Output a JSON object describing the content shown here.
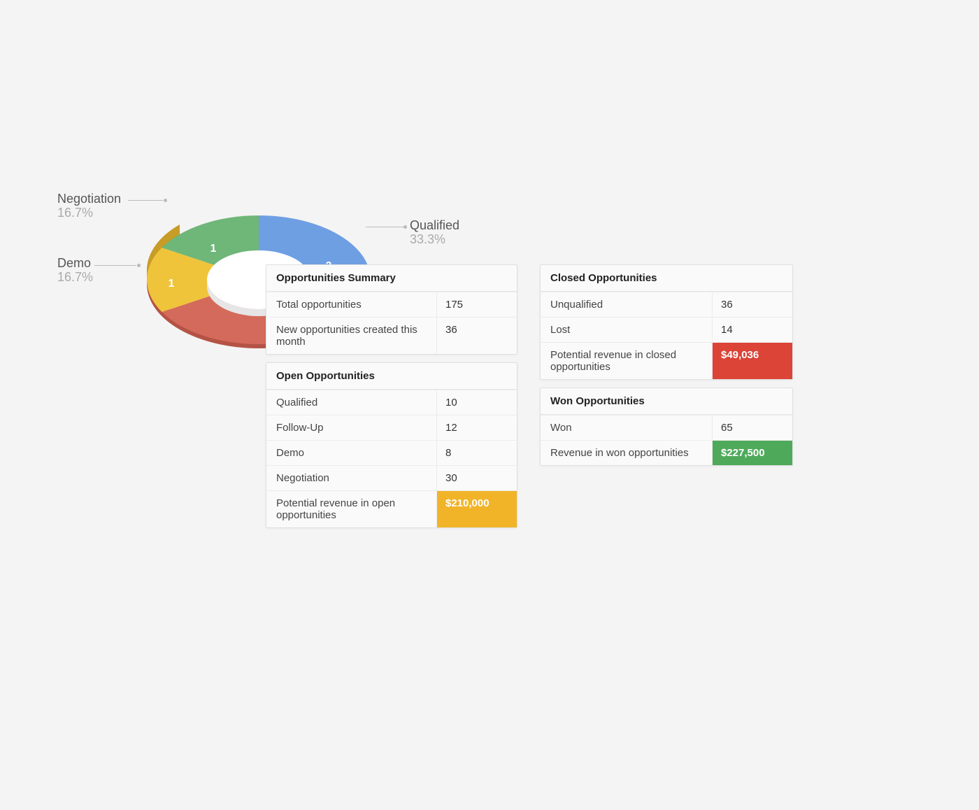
{
  "chart_data": {
    "type": "pie",
    "style": "3d-donut",
    "series": [
      {
        "name": "Qualified",
        "value": 2,
        "percent": "33.3%",
        "color": "#6f9fe3"
      },
      {
        "name": "Follow-Up",
        "value": 2,
        "percent": "33.3%",
        "color": "#d46a5b"
      },
      {
        "name": "Demo",
        "value": 1,
        "percent": "16.7%",
        "color": "#efc43b"
      },
      {
        "name": "Negotiation",
        "value": 1,
        "percent": "16.7%",
        "color": "#6fb679"
      }
    ],
    "inner_radius_ratio": 0.45,
    "visible_labels": [
      "Qualified",
      "Demo",
      "Negotiation"
    ]
  },
  "labels": {
    "qualified": {
      "name": "Qualified",
      "pct": "33.3%"
    },
    "demo": {
      "name": "Demo",
      "pct": "16.7%"
    },
    "negotiation": {
      "name": "Negotiation",
      "pct": "16.7%"
    }
  },
  "slice_counts": {
    "qualified": "2",
    "demo": "1",
    "negotiation": "1"
  },
  "panels": {
    "summary": {
      "title": "Opportunities Summary",
      "rows": [
        {
          "label": "Total opportunities",
          "value": "175"
        },
        {
          "label": "New opportunities created this month",
          "value": "36"
        }
      ]
    },
    "open": {
      "title": "Open Opportunities",
      "rows": [
        {
          "label": "Qualified",
          "value": "10"
        },
        {
          "label": "Follow-Up",
          "value": "12"
        },
        {
          "label": "Demo",
          "value": "8"
        },
        {
          "label": "Negotiation",
          "value": "30"
        }
      ],
      "highlight": {
        "label": "Potential revenue in open opportunities",
        "value": "$210,000"
      }
    },
    "closed": {
      "title": "Closed Opportunities",
      "rows": [
        {
          "label": "Unqualified",
          "value": "36"
        },
        {
          "label": "Lost",
          "value": "14"
        }
      ],
      "highlight": {
        "label": "Potential revenue in closed opportunities",
        "value": "$49,036"
      }
    },
    "won": {
      "title": "Won Opportunities",
      "rows": [
        {
          "label": "Won",
          "value": "65"
        }
      ],
      "highlight": {
        "label": "Revenue in won opportunities",
        "value": "$227,500"
      }
    }
  }
}
